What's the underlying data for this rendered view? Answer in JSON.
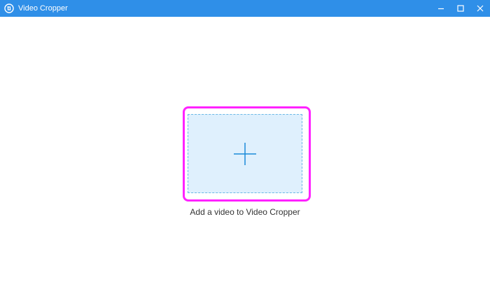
{
  "window": {
    "title": "Video Cropper",
    "app_icon": "video-cropper-app-icon",
    "controls": {
      "minimize_icon": "minimize-icon",
      "maximize_icon": "maximize-icon",
      "close_icon": "close-icon"
    }
  },
  "main": {
    "drop_zone_icon": "plus-icon",
    "add_label": "Add a video to Video Cropper"
  },
  "colors": {
    "titlebar": "#2f8fe8",
    "drop_zone_fill": "#dff0fd",
    "drop_zone_border": "#6ab8e6",
    "plus": "#1a8ad8",
    "highlight": "#ff22ff",
    "label_text": "#333333"
  }
}
